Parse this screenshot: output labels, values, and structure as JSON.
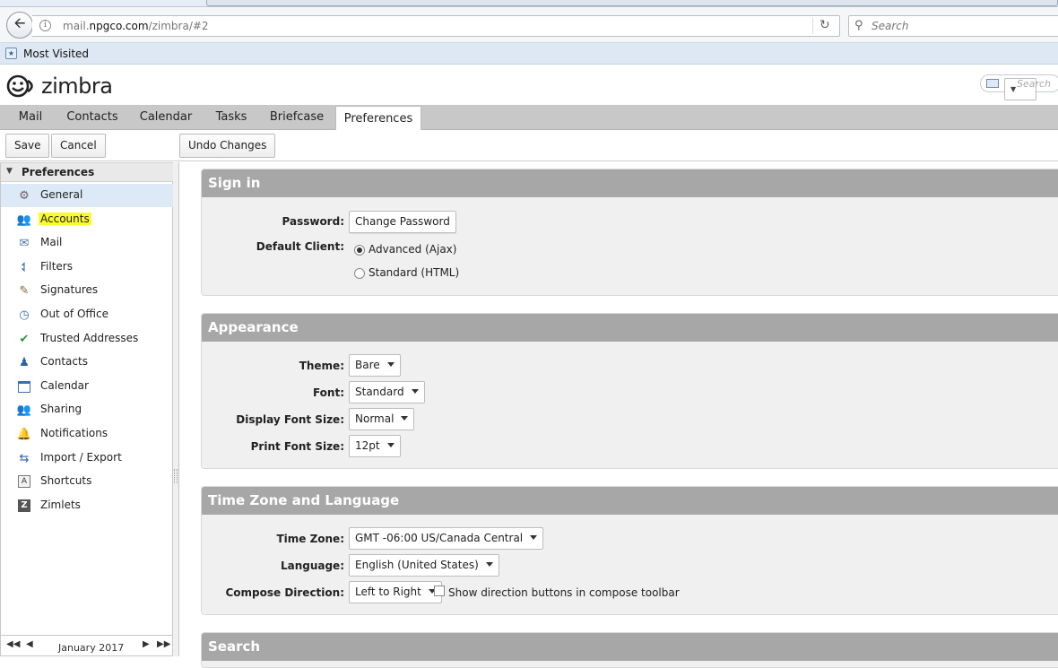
{
  "browser": {
    "url_prefix": "mail.",
    "url_domain": "npgco.com",
    "url_path": "/zimbra/#2",
    "search_placeholder": "Search",
    "bookmark_label": "Most Visited"
  },
  "zimbra": {
    "logo_text": "zimbra",
    "search_placeholder": "Search"
  },
  "app_tabs": [
    "Mail",
    "Contacts",
    "Calendar",
    "Tasks",
    "Briefcase",
    "Preferences"
  ],
  "active_tab": "Preferences",
  "toolbar": {
    "save": "Save",
    "cancel": "Cancel",
    "undo": "Undo Changes"
  },
  "sidebar": {
    "header": "Preferences",
    "items": [
      {
        "label": "General",
        "icon": "gear-icon"
      },
      {
        "label": "Accounts",
        "icon": "accounts-icon"
      },
      {
        "label": "Mail",
        "icon": "mail-icon"
      },
      {
        "label": "Filters",
        "icon": "filter-icon"
      },
      {
        "label": "Signatures",
        "icon": "signature-icon"
      },
      {
        "label": "Out of Office",
        "icon": "out-of-office-icon"
      },
      {
        "label": "Trusted Addresses",
        "icon": "shield-icon"
      },
      {
        "label": "Contacts",
        "icon": "contact-icon"
      },
      {
        "label": "Calendar",
        "icon": "calendar-icon"
      },
      {
        "label": "Sharing",
        "icon": "sharing-icon"
      },
      {
        "label": "Notifications",
        "icon": "bell-icon"
      },
      {
        "label": "Import / Export",
        "icon": "import-export-icon"
      },
      {
        "label": "Shortcuts",
        "icon": "keyboard-shortcut-icon"
      },
      {
        "label": "Zimlets",
        "icon": "zimlet-icon"
      }
    ],
    "selected": "General",
    "highlighted": "Accounts"
  },
  "mini_calendar": {
    "month": "January 2017"
  },
  "sections": {
    "signin": {
      "title": "Sign in",
      "password_label": "Password:",
      "change_password": "Change Password",
      "default_client_label": "Default Client:",
      "client_advanced": "Advanced (Ajax)",
      "client_standard": "Standard (HTML)",
      "selected_client": "Advanced (Ajax)"
    },
    "appearance": {
      "title": "Appearance",
      "theme_label": "Theme:",
      "theme_value": "Bare",
      "font_label": "Font:",
      "font_value": "Standard",
      "display_font_size_label": "Display Font Size:",
      "display_font_size_value": "Normal",
      "print_font_size_label": "Print Font Size:",
      "print_font_size_value": "12pt"
    },
    "timezone": {
      "title": "Time Zone and Language",
      "tz_label": "Time Zone:",
      "tz_value": "GMT -06:00 US/Canada Central",
      "lang_label": "Language:",
      "lang_value": "English (United States)",
      "compose_dir_label": "Compose Direction:",
      "compose_dir_value": "Left to Right",
      "show_dir_buttons": "Show direction buttons in compose toolbar",
      "show_dir_checked": false
    },
    "search": {
      "title": "Search"
    }
  },
  "colors": {
    "section_header": "#a7a7a7",
    "highlight": "#fbfb2c",
    "selected_row": "#dde9f6"
  }
}
